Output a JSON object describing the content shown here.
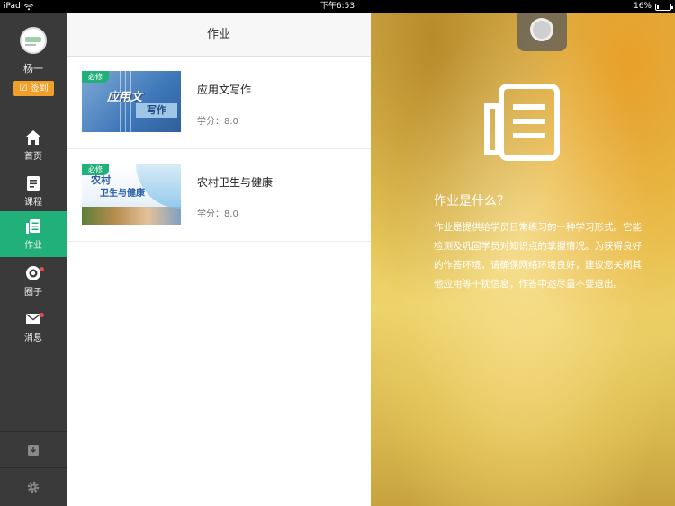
{
  "status_bar": {
    "device": "iPad",
    "time": "下午6:53",
    "battery": "16%",
    "battery_level": 0.16
  },
  "sidebar": {
    "user_name": "杨一",
    "signin_label": "签到",
    "items": [
      {
        "label": "首页",
        "icon": "home-icon",
        "active": false
      },
      {
        "label": "课程",
        "icon": "course-icon",
        "active": false
      },
      {
        "label": "作业",
        "icon": "homework-icon",
        "active": true
      },
      {
        "label": "圈子",
        "icon": "circle-icon",
        "active": false,
        "badge": true
      },
      {
        "label": "消息",
        "icon": "mail-icon",
        "active": false,
        "badge": true
      }
    ],
    "bottom_icons": [
      "download-icon",
      "gear-icon"
    ]
  },
  "list": {
    "header_title": "作业",
    "courses": [
      {
        "tag": "必修",
        "title": "应用文写作",
        "credit": "学分：8.0",
        "thumb_text1": "应用文",
        "thumb_text2": "写作"
      },
      {
        "tag": "必修",
        "title": "农村卫生与健康",
        "credit": "学分：8.0",
        "thumb_text1": "农村",
        "thumb_text2": "卫生与健康"
      }
    ]
  },
  "info_panel": {
    "title": "作业是什么？",
    "description": "作业是提供给学员日常练习的一种学习形式。它能检测及巩固学员对知识点的掌握情况。为获得良好的作答环境，请确保网络环境良好，建议您关闭其他应用等干扰信息，作答中途尽量不要退出。"
  },
  "colors": {
    "sidebar_bg": "#3a3a3a",
    "accent_green": "#22b07a",
    "signin_orange": "#f0a02a",
    "badge_red": "#e94a4a"
  }
}
